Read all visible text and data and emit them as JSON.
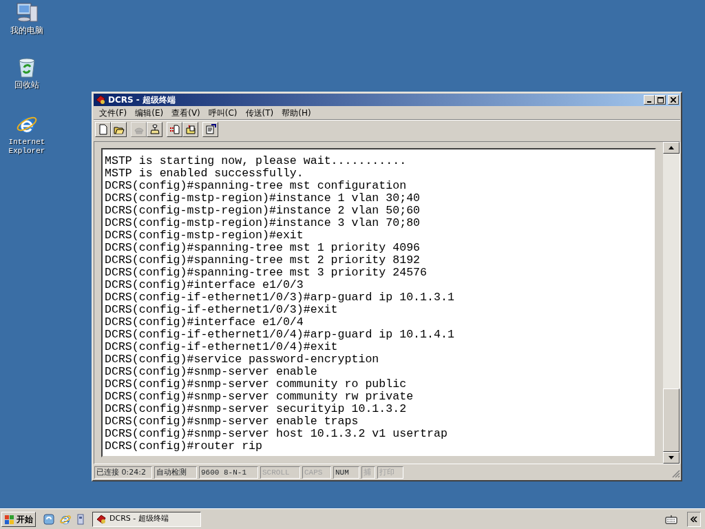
{
  "desktop_icons": [
    {
      "label": "我的电脑",
      "kind": "computer"
    },
    {
      "label": "回收站",
      "kind": "recycle"
    },
    {
      "label": "Internet Explorer",
      "kind": "ie"
    }
  ],
  "window": {
    "title": "DCRS - 超级终端",
    "active": true
  },
  "menu": [
    "文件(F)",
    "编辑(E)",
    "查看(V)",
    "呼叫(C)",
    "传送(T)",
    "帮助(H)"
  ],
  "toolbar": [
    [
      {
        "kind": "new",
        "disabled": false
      },
      {
        "kind": "open",
        "disabled": false
      }
    ],
    [
      {
        "kind": "call",
        "disabled": true
      },
      {
        "kind": "hangup",
        "disabled": false
      }
    ],
    [
      {
        "kind": "send",
        "disabled": false
      },
      {
        "kind": "receive",
        "disabled": false
      }
    ],
    [
      {
        "kind": "properties",
        "disabled": false
      }
    ]
  ],
  "terminal_lines": [
    "MSTP is starting now, please wait...........",
    "MSTP is enabled successfully.",
    "DCRS(config)#spanning-tree mst configuration",
    "DCRS(config-mstp-region)#instance 1 vlan 30;40",
    "DCRS(config-mstp-region)#instance 2 vlan 50;60",
    "DCRS(config-mstp-region)#instance 3 vlan 70;80",
    "DCRS(config-mstp-region)#exit",
    "DCRS(config)#spanning-tree mst 1 priority 4096",
    "DCRS(config)#spanning-tree mst 2 priority 8192",
    "DCRS(config)#spanning-tree mst 3 priority 24576",
    "DCRS(config)#interface e1/0/3",
    "DCRS(config-if-ethernet1/0/3)#arp-guard ip 10.1.3.1",
    "DCRS(config-if-ethernet1/0/3)#exit",
    "DCRS(config)#interface e1/0/4",
    "DCRS(config-if-ethernet1/0/4)#arp-guard ip 10.1.4.1",
    "DCRS(config-if-ethernet1/0/4)#exit",
    "DCRS(config)#service password-encryption",
    "DCRS(config)#snmp-server enable",
    "DCRS(config)#snmp-server community ro public",
    "DCRS(config)#snmp-server community rw private",
    "DCRS(config)#snmp-server securityip 10.1.3.2",
    "DCRS(config)#snmp-server enable traps",
    "DCRS(config)#snmp-server host 10.1.3.2 v1 usertrap",
    "DCRS(config)#router rip"
  ],
  "status_bar": [
    {
      "text": "已连接 0:24:2",
      "enabled": true
    },
    {
      "text": "自动检测",
      "enabled": true
    },
    {
      "text": "9600 8-N-1",
      "enabled": true
    },
    {
      "text": "SCROLL",
      "enabled": false
    },
    {
      "text": "CAPS",
      "enabled": false
    },
    {
      "text": "NUM",
      "enabled": true
    },
    {
      "text": "捕",
      "enabled": false
    },
    {
      "text": "打印",
      "enabled": false
    }
  ],
  "taskbar": {
    "start_label": "开始",
    "tasks": [
      {
        "label": "DCRS - 超级终端",
        "selected": true
      }
    ]
  }
}
